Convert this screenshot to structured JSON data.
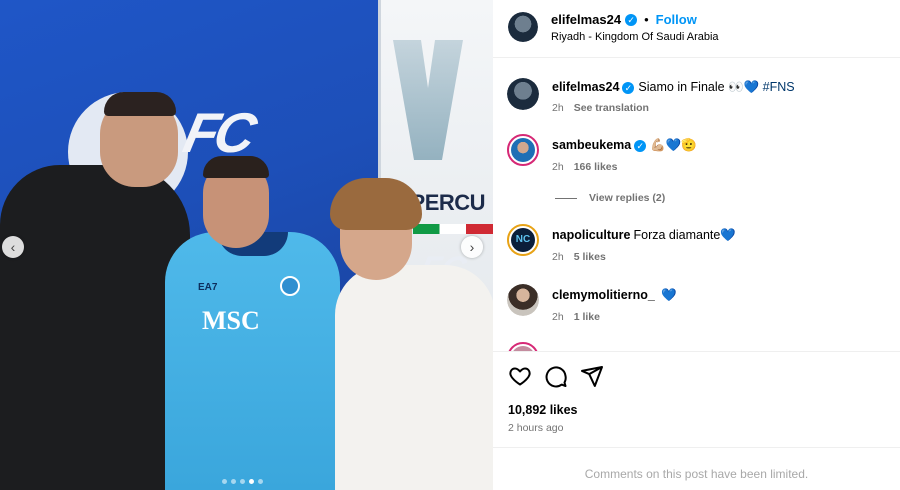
{
  "header": {
    "username": "elifelmas24",
    "follow_label": "Follow",
    "location": "Riyadh - Kingdom Of Saudi Arabia"
  },
  "photo": {
    "jersey_sponsor": "MSC",
    "jersey_brand": "EA7",
    "backdrop_text": "SUPERCU",
    "slide_count": 5,
    "active_slide": 4
  },
  "caption": {
    "username": "elifelmas24",
    "text": "Siamo in Finale 👀💙",
    "hashtag": "#FNS",
    "time": "2h",
    "translate_label": "See translation"
  },
  "comments": [
    {
      "username": "sambeukema",
      "text": "💪🏼💙🫡",
      "time": "2h",
      "likes": "166 likes",
      "verified": true,
      "replies": "View replies (2)"
    },
    {
      "username": "napoliculture",
      "text": "Forza diamante💙",
      "time": "2h",
      "likes": "5 likes",
      "verified": false,
      "avatar_text": "NC"
    },
    {
      "username": "clemymolitierno_",
      "text": "💙",
      "time": "2h",
      "likes": "1 like",
      "verified": false
    }
  ],
  "actions": {
    "likes": "10,892 likes",
    "time_ago": "2 hours ago",
    "limited_notice": "Comments on this post have been limited."
  },
  "colors": {
    "accent": "#0095f6",
    "secondary_text": "#737373",
    "photo_background": "#1d4fb8"
  }
}
